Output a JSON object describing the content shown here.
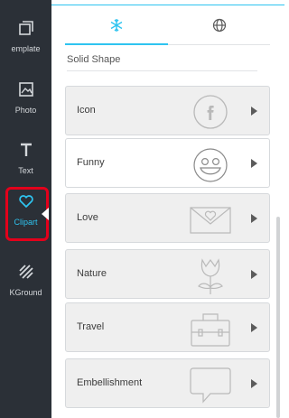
{
  "sidebar": {
    "items": [
      {
        "label": "emplate",
        "icon": "template-icon"
      },
      {
        "label": "Photo",
        "icon": "photo-icon"
      },
      {
        "label": "Text",
        "icon": "text-icon"
      },
      {
        "label": "Clipart",
        "icon": "heart-icon",
        "active": true
      },
      {
        "label": "KGround",
        "icon": "background-icon"
      }
    ]
  },
  "tabs": [
    {
      "name": "clipart-category-tab",
      "icon": "snowflake-icon",
      "active": true
    },
    {
      "name": "web-clipart-tab",
      "icon": "globe-icon",
      "active": false
    }
  ],
  "solid_shape_label": "Solid Shape",
  "categories": [
    {
      "label": "Icon",
      "thumb": "facebook-circle-icon"
    },
    {
      "label": "Funny",
      "thumb": "smiley-face-icon"
    },
    {
      "label": "Love",
      "thumb": "heart-envelope-icon"
    },
    {
      "label": "Nature",
      "thumb": "tulip-icon"
    },
    {
      "label": "Travel",
      "thumb": "suitcase-icon"
    },
    {
      "label": "Embellishment",
      "thumb": "speech-bubble-icon"
    }
  ],
  "colors": {
    "accent": "#2ec4f0",
    "sidebar_bg": "#2b3037",
    "active_outline": "#e3001b",
    "card_bg": "#efefef"
  }
}
